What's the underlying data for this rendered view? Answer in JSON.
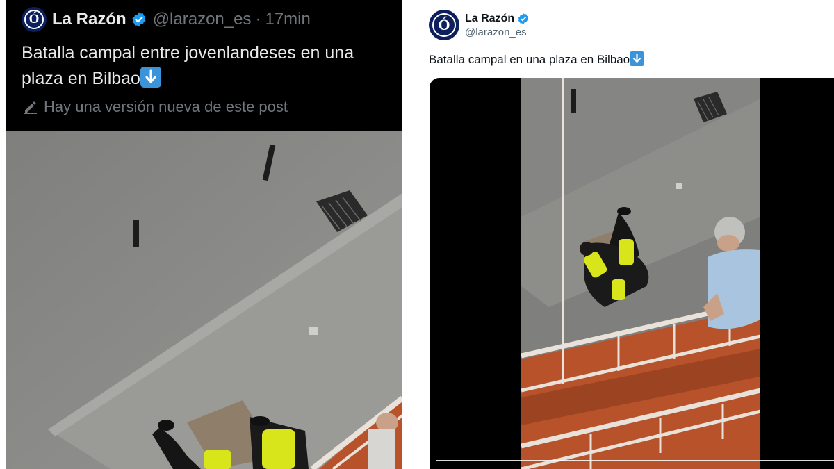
{
  "left_tweet": {
    "avatar_char": "Ó",
    "display_name": "La Razón",
    "handle": "@larazon_es",
    "separator": "·",
    "time": "17min",
    "text": "Batalla campal entre jovenlandeses en una plaza en Bilbao",
    "emoji_icon": "down-arrow-emoji",
    "edit_notice": "Hay una versión nueva de este post"
  },
  "right_tweet": {
    "avatar_char": "Ó",
    "display_name": "La Razón",
    "handle": "@larazon_es",
    "text": "Batalla campal en una plaza en Bilbao",
    "emoji_icon": "down-arrow-emoji"
  },
  "colors": {
    "verified_blue": "#1d9bf0",
    "avatar_navy": "#0d1f5c",
    "dark_bg": "#000000",
    "emoji_blue": "#3b94d9",
    "vest_yellow": "#d8e51a",
    "railing_orange": "#b8522a"
  },
  "video": {
    "progress": 1.0
  }
}
